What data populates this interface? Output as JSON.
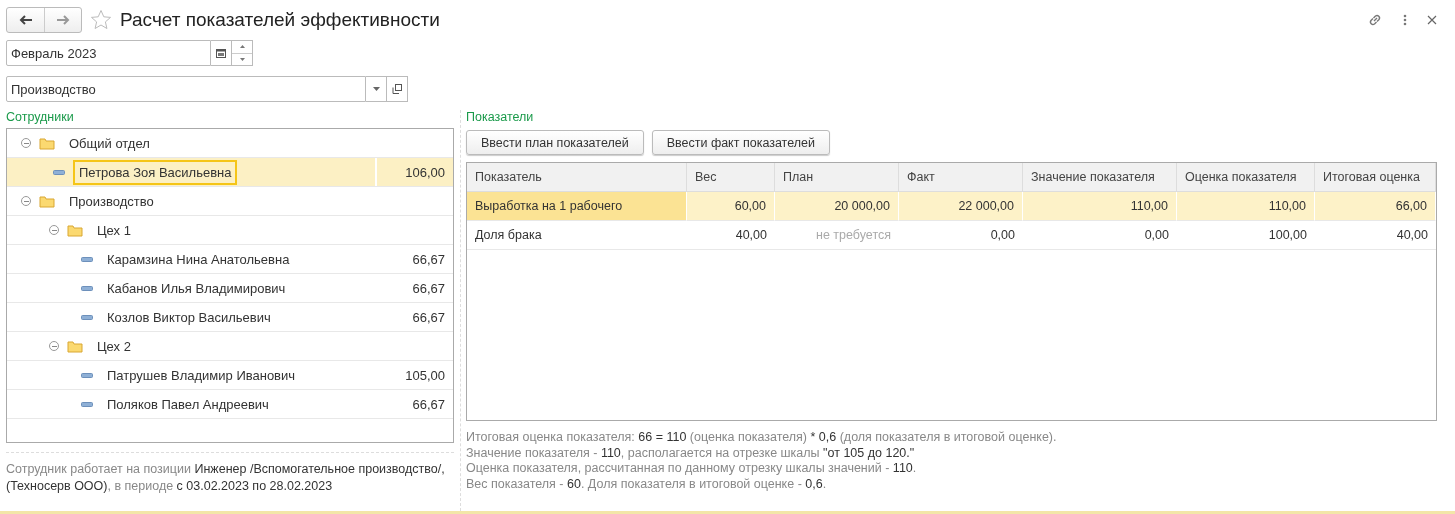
{
  "window": {
    "title": "Расчет показателей эффективности",
    "favorite": false
  },
  "period": {
    "value": "Февраль 2023"
  },
  "department": {
    "value": "Производство"
  },
  "employees": {
    "label": "Сотрудники",
    "tree": [
      {
        "kind": "group",
        "name": "Общий отдел",
        "expanded": true,
        "children": [
          {
            "kind": "person",
            "name": "Петрова Зоя Васильевна",
            "score": "106,00",
            "selected": true
          }
        ]
      },
      {
        "kind": "group",
        "name": "Производство",
        "expanded": true,
        "children": [
          {
            "kind": "group",
            "name": "Цех 1",
            "expanded": true,
            "children": [
              {
                "kind": "person",
                "name": "Карамзина Нина Анатольевна",
                "score": "66,67",
                "selected": false
              },
              {
                "kind": "person",
                "name": "Кабанов Илья Владимирович",
                "score": "66,67",
                "selected": false
              },
              {
                "kind": "person",
                "name": "Козлов Виктор Васильевич",
                "score": "66,67",
                "selected": false
              }
            ]
          },
          {
            "kind": "group",
            "name": "Цех 2",
            "expanded": true,
            "children": [
              {
                "kind": "person",
                "name": "Патрушев Владимир Иванович",
                "score": "105,00",
                "selected": false
              },
              {
                "kind": "person",
                "name": "Поляков Павел Андреевич",
                "score": "66,67",
                "selected": false
              }
            ]
          }
        ]
      }
    ],
    "note": "Сотрудник работает на позиции **Инженер /Вспомогательное производство/, (Техносерв ООО)**, в периоде **с 03.02.2023 по 28.02.2023**"
  },
  "indicators": {
    "label": "Показатели",
    "buttons": [
      "Ввести план показателей",
      "Ввести факт показателей"
    ],
    "columns": [
      "Показатель",
      "Вес",
      "План",
      "Факт",
      "Значение показателя",
      "Оценка показателя",
      "Итоговая оценка"
    ],
    "rows": [
      {
        "selected": true,
        "cells": [
          "Выработка на 1 рабочего",
          "60,00",
          "20 000,00",
          "22 000,00",
          "110,00",
          "110,00",
          "66,00"
        ],
        "plan_required": true
      },
      {
        "selected": false,
        "cells": [
          "Доля брака",
          "40,00",
          "не требуется",
          "0,00",
          "0,00",
          "100,00",
          "40,00"
        ],
        "plan_required": false
      }
    ],
    "explanation": [
      "Итоговая оценка показателя: **66 = 110** (оценка показателя) *** 0,6** (доля показателя в итоговой оценке).",
      "Значение показателя - **110**, располагается на отрезке шкалы **\"от 105 до 120.\"**",
      "Оценка показателя, рассчитанная по данному отрезку шкалы значений - **110**.",
      "Вес показателя - **60**. Доля показателя в итоговой оценке - **0,6**."
    ]
  }
}
